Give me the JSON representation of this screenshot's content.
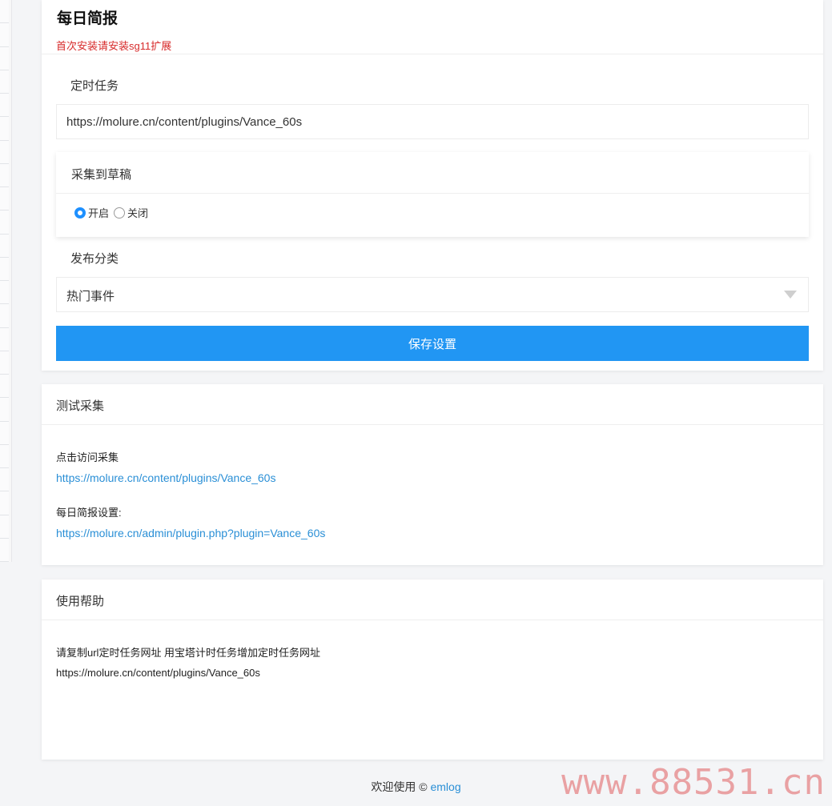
{
  "main": {
    "title": "每日简报",
    "note": "首次安装请安装sg11扩展",
    "cron_label": "定时任务",
    "cron_value": "https://molure.cn/content/plugins/Vance_60s",
    "draft_label": "采集到草稿",
    "draft_options": {
      "on": "开启",
      "off": "关闭"
    },
    "category_label": "发布分类",
    "category_value": "热门事件",
    "save_label": "保存设置"
  },
  "test": {
    "title": "测试采集",
    "visit_text": "点击访问采集",
    "visit_link": "https://molure.cn/content/plugins/Vance_60s",
    "settings_text": "每日简报设置:",
    "settings_link": "https://molure.cn/admin/plugin.php?plugin=Vance_60s"
  },
  "help": {
    "title": "使用帮助",
    "line1": "请复制url定时任务网址 用宝塔计时任务增加定时任务网址",
    "line2": "https://molure.cn/content/plugins/Vance_60s"
  },
  "footer": {
    "prefix": "欢迎使用 ©",
    "link": "emlog"
  },
  "watermark": "www.88531.cn",
  "colors": {
    "accent": "#2196f3",
    "link": "#2a8fd6",
    "warning": "#d72b2b"
  }
}
